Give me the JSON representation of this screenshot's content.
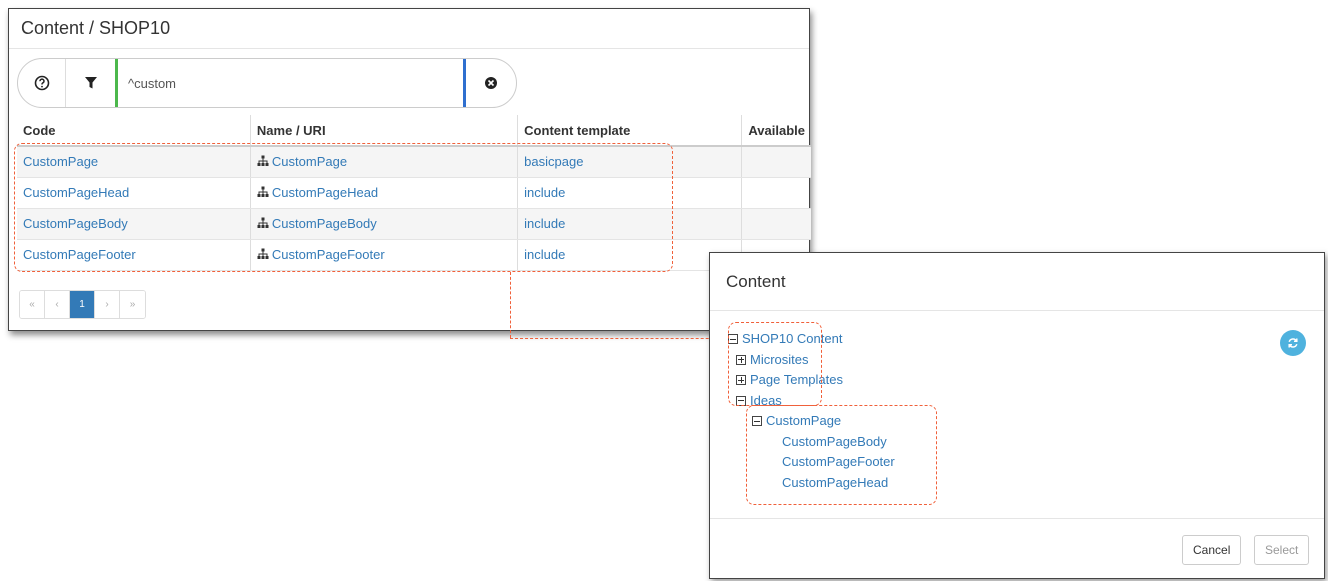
{
  "left_window": {
    "title": "Content / SHOP10",
    "filter": {
      "value": "^custom"
    },
    "columns": [
      "Code",
      "Name / URI",
      "Content template",
      "Available"
    ],
    "rows": [
      {
        "code": "CustomPage",
        "name": "CustomPage",
        "template": "basicpage"
      },
      {
        "code": "CustomPageHead",
        "name": "CustomPageHead",
        "template": "include"
      },
      {
        "code": "CustomPageBody",
        "name": "CustomPageBody",
        "template": "include"
      },
      {
        "code": "CustomPageFooter",
        "name": "CustomPageFooter",
        "template": "include"
      }
    ],
    "pagination": {
      "first": "«",
      "prev": "‹",
      "current": "1",
      "next": "›",
      "last": "»"
    }
  },
  "dialog": {
    "title": "Content",
    "tree": {
      "root": "SHOP10 Content",
      "microsites": "Microsites",
      "page_templates": "Page Templates",
      "ideas": "Ideas",
      "custom_page": "CustomPage",
      "children": [
        "CustomPageBody",
        "CustomPageFooter",
        "CustomPageHead"
      ]
    },
    "cancel_label": "Cancel",
    "select_label": "Select"
  },
  "colors": {
    "link": "#337ab7",
    "highlight_dash": "#f0603a",
    "filter_accent": "#4cb84c",
    "input_accent": "#2f6fcf",
    "refresh": "#4fb2de"
  },
  "icons": [
    "help-icon",
    "filter-icon",
    "clear-icon",
    "sitemap-icon",
    "refresh-icon",
    "collapse-icon",
    "expand-icon"
  ]
}
